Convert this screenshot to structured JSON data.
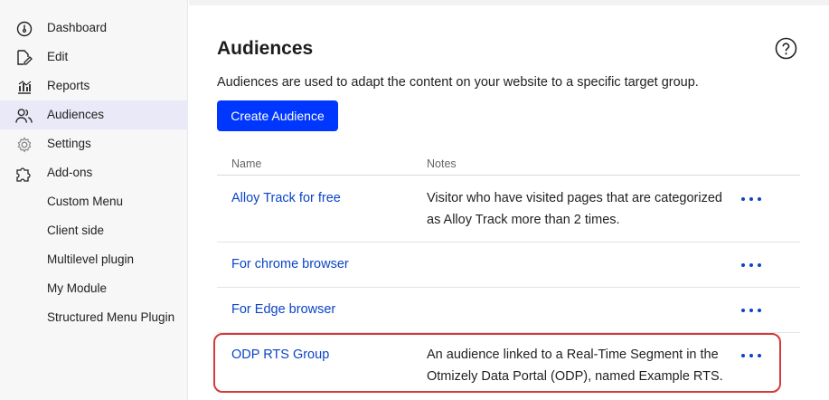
{
  "sidebar": {
    "items": [
      {
        "label": "Dashboard",
        "icon": "dashboard-icon"
      },
      {
        "label": "Edit",
        "icon": "edit-icon"
      },
      {
        "label": "Reports",
        "icon": "reports-icon"
      },
      {
        "label": "Audiences",
        "icon": "audiences-icon",
        "active": true
      },
      {
        "label": "Settings",
        "icon": "settings-icon"
      },
      {
        "label": "Add-ons",
        "icon": "addons-icon"
      }
    ],
    "subitems": [
      {
        "label": "Custom Menu"
      },
      {
        "label": "Client side"
      },
      {
        "label": "Multilevel plugin"
      },
      {
        "label": "My Module"
      },
      {
        "label": "Structured Menu Plugin"
      }
    ]
  },
  "main": {
    "title": "Audiences",
    "help_icon": "help-icon",
    "intro": "Audiences are used to adapt the content on your website to a specific target group.",
    "create_button": "Create Audience",
    "table": {
      "headers": {
        "name": "Name",
        "notes": "Notes"
      },
      "rows": [
        {
          "name": "Alloy Track for free",
          "notes": "Visitor who have visited pages that are categorized as Alloy Track more than 2 times."
        },
        {
          "name": "For chrome browser",
          "notes": ""
        },
        {
          "name": "For Edge browser",
          "notes": ""
        },
        {
          "name": "ODP RTS Group",
          "notes": "An audience linked to a Real-Time Segment in the Otmizely Data Portal (ODP), named Example RTS."
        }
      ]
    }
  },
  "colors": {
    "accent": "#0037ff",
    "link": "#0b44c7",
    "highlight": "#d63a3a",
    "active_bg": "#e9e9f7"
  }
}
